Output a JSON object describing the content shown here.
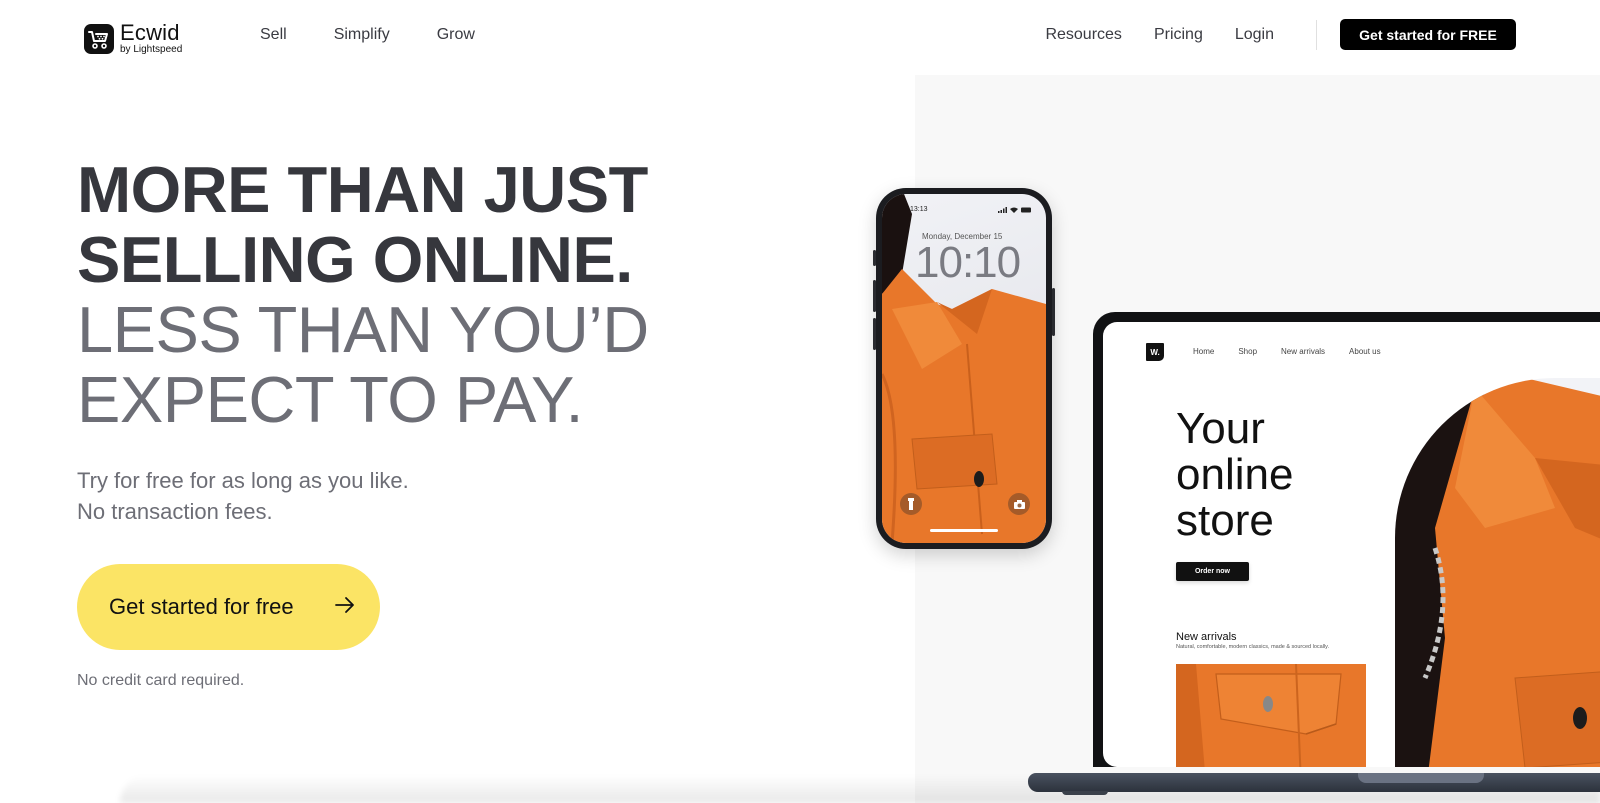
{
  "header": {
    "logo": {
      "name": "Ecwid",
      "subtitle": "by Lightspeed",
      "icon": "shopping-cart-icon"
    },
    "nav_left": [
      {
        "label": "Sell"
      },
      {
        "label": "Simplify"
      },
      {
        "label": "Grow"
      }
    ],
    "nav_right": [
      {
        "label": "Resources"
      },
      {
        "label": "Pricing"
      },
      {
        "label": "Login"
      }
    ],
    "cta_label": "Get started for FREE"
  },
  "hero": {
    "headline_strong": [
      "MORE THAN JUST",
      "SELLING ONLINE."
    ],
    "headline_light": [
      "LESS THAN YOU’D",
      "EXPECT TO PAY."
    ],
    "subtext": [
      "Try for free for as long as you like.",
      "No transaction fees."
    ],
    "cta_label": "Get started for free",
    "cta_icon": "arrow-right-icon",
    "note": "No credit card required."
  },
  "phone": {
    "status_time": "13:13",
    "date": "Monday, December 15",
    "clock": "10:10",
    "icons": [
      "signal-icon",
      "wifi-icon",
      "battery-icon",
      "flashlight-icon",
      "camera-icon"
    ]
  },
  "laptop_site": {
    "logo": "W.",
    "nav": [
      "Home",
      "Shop",
      "New arrivals",
      "About us"
    ],
    "hero_title": [
      "Your",
      "online",
      "store"
    ],
    "order_button": "Order now",
    "new_arrivals_title": "New arrivals",
    "new_arrivals_sub": "Natural, comfortable, modern classics, made & sourced locally."
  },
  "colors": {
    "cta_yellow": "#fbe465",
    "heading_dark": "#36373d",
    "heading_light": "#6d6e76",
    "jacket_orange": "#e8772a",
    "header_cta_bg": "#000000"
  }
}
